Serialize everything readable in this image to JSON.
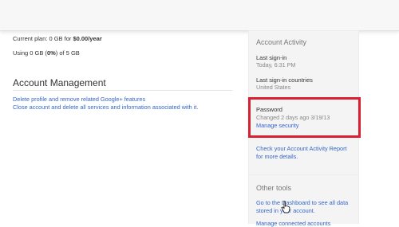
{
  "storage": {
    "current_plan_prefix": "Current plan: 0 GB for ",
    "current_plan_price": "$0.00/year",
    "usage_prefix": "Using 0 GB (",
    "usage_percent": "0%",
    "usage_suffix": ") of 5 GB"
  },
  "account_management": {
    "title": "Account Management",
    "links": [
      "Delete profile and remove related Google+ features",
      "Close account and delete all services and information associated with it."
    ]
  },
  "account_activity": {
    "title": "Account Activity",
    "last_signin_label": "Last sign-in",
    "last_signin_value": "Today, 6:31 PM",
    "countries_label": "Last sign-in countries",
    "countries_value": "United States",
    "password_label": "Password",
    "password_value": "Changed 2 days ago 3/19/13",
    "manage_security": "Manage security",
    "report_link_line1": "Check your Account Activity Report",
    "report_link_line2": "for more details."
  },
  "other_tools": {
    "title": "Other tools",
    "dashboard_line1": "Go to the Dashboard to see all data",
    "dashboard_line2": "stored in your account.",
    "connected_accounts": "Manage connected accounts"
  },
  "colors": {
    "link": "#3366cc",
    "highlight_border": "#d92033",
    "panel_bg": "#f4f4f4"
  }
}
